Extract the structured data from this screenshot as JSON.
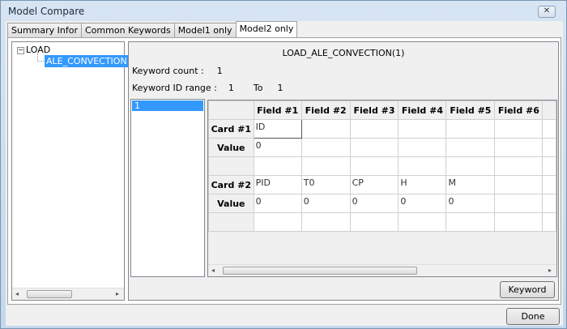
{
  "window": {
    "title": "Model Compare",
    "close": "✕"
  },
  "tabs": [
    "Summary Infor",
    "Common Keywords",
    "Model1 only",
    "Model2 only"
  ],
  "tree": {
    "root": "LOAD",
    "child": "ALE_CONVECTION",
    "expand": "−"
  },
  "detail": {
    "title": "LOAD_ALE_CONVECTION(1)",
    "count_label": "Keyword count :",
    "count": "1",
    "range_label": "Keyword ID range :",
    "range_from": "1",
    "to_label": "To",
    "range_to": "1"
  },
  "list": [
    "1"
  ],
  "grid": {
    "headers": [
      "Field #1",
      "Field #2",
      "Field #3",
      "Field #4",
      "Field #5",
      "Field #6"
    ],
    "rows": [
      {
        "label": "Card #1",
        "cells": [
          "ID",
          "",
          "",
          "",
          "",
          ""
        ]
      },
      {
        "label": "Value",
        "cells": [
          "0",
          "",
          "",
          "",
          "",
          ""
        ]
      },
      {
        "label": "",
        "cells": [
          "",
          "",
          "",
          "",
          "",
          ""
        ]
      },
      {
        "label": "Card #2",
        "cells": [
          "PID",
          "T0",
          "CP",
          "H",
          "M",
          ""
        ]
      },
      {
        "label": "Value",
        "cells": [
          "0",
          "0",
          "0",
          "0",
          "0",
          ""
        ]
      },
      {
        "label": "",
        "cells": [
          "",
          "",
          "",
          "",
          "",
          ""
        ]
      }
    ]
  },
  "buttons": {
    "keyword": "Keyword",
    "done": "Done"
  },
  "scroll": {
    "left": "◂",
    "right": "▸"
  }
}
